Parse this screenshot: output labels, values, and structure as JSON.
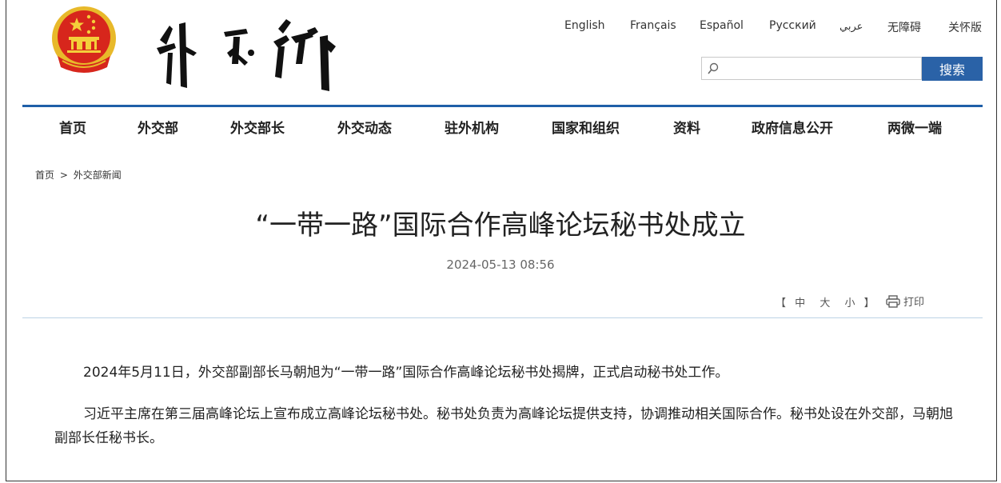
{
  "header": {
    "languages": [
      "English",
      "Français",
      "Español",
      "Русский",
      "عربي",
      "无障碍",
      "关怀版"
    ],
    "search": {
      "placeholder": "",
      "button_label": "搜索"
    }
  },
  "nav": {
    "items": [
      "首页",
      "外交部",
      "外交部长",
      "外交动态",
      "驻外机构",
      "国家和组织",
      "资料",
      "政府信息公开",
      "两微一端"
    ]
  },
  "breadcrumb": {
    "home": "首页",
    "separator": ">",
    "current": "外交部新闻"
  },
  "article": {
    "title": "“一带一路”国际合作高峰论坛秘书处成立",
    "date": "2024-05-13 08:56",
    "font_size": {
      "open": "【",
      "medium": "中",
      "large": "大",
      "small": "小",
      "close": "】"
    },
    "print_label": "打印",
    "paragraphs": [
      "2024年5月11日，外交部副部长马朝旭为“一带一路”国际合作高峰论坛秘书处揭牌，正式启动秘书处工作。",
      "习近平主席在第三届高峰论坛上宣布成立高峰论坛秘书处。秘书处负责为高峰论坛提供支持，协调推动相关国际合作。秘书处设在外交部，马朝旭副部长任秘书长。"
    ]
  },
  "colors": {
    "accent": "#2a62a7",
    "nav_rule": "#1f5fa8",
    "content_rule": "#bcd3e6",
    "emblem_red": "#d7261c",
    "emblem_gold": "#e8b92a"
  },
  "icons": [
    "national-emblem",
    "search-icon",
    "printer-icon"
  ]
}
